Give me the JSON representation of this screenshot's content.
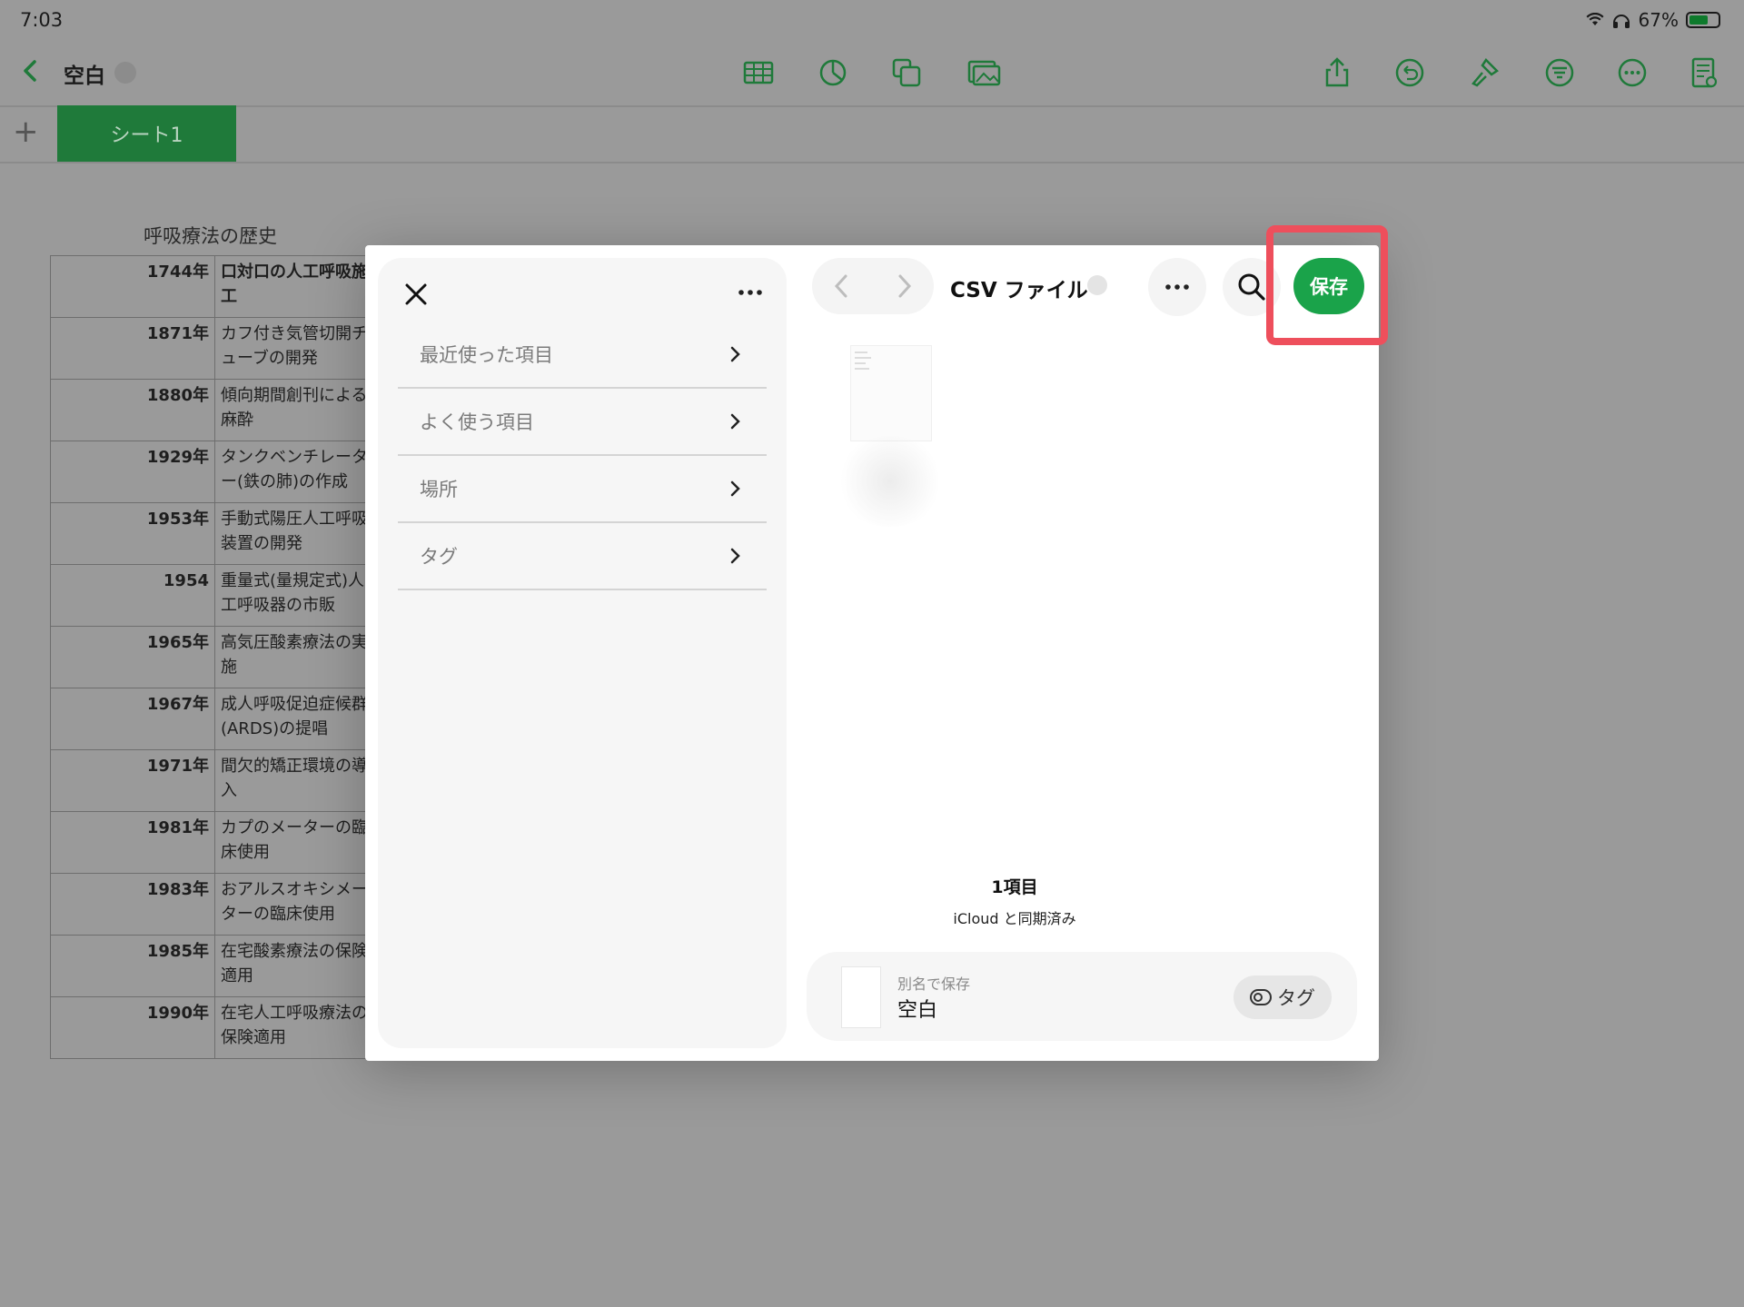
{
  "status": {
    "time": "7:03",
    "battery": "67%"
  },
  "toolbar": {
    "doc_title": "空白"
  },
  "tabs": {
    "sheet1": "シート1"
  },
  "table": {
    "title": "呼吸療法の歴史",
    "rows": [
      {
        "year": "1744年",
        "event": "口対口の人工呼吸施工"
      },
      {
        "year": "1871年",
        "event": "カフ付き気管切開チューブの開発"
      },
      {
        "year": "1880年",
        "event": "傾向期間創刊による麻酔"
      },
      {
        "year": "1929年",
        "event": "タンクベンチレーター(鉄の肺)の作成"
      },
      {
        "year": "1953年",
        "event": "手動式陽圧人工呼吸装置の開発"
      },
      {
        "year": "1954",
        "event": "重量式(量規定式)人工呼吸器の市販"
      },
      {
        "year": "1965年",
        "event": "高気圧酸素療法の実施"
      },
      {
        "year": "1967年",
        "event": "成人呼吸促迫症候群(ARDS)の提唱"
      },
      {
        "year": "1971年",
        "event": "間欠的矯正環境の導入"
      },
      {
        "year": "1981年",
        "event": "カプのメーターの臨床使用"
      },
      {
        "year": "1983年",
        "event": "おアルスオキシメーターの臨床使用"
      },
      {
        "year": "1985年",
        "event": "在宅酸素療法の保険適用"
      },
      {
        "year": "1990年",
        "event": "在宅人工呼吸療法の保険適用"
      }
    ]
  },
  "dialog": {
    "sidebar_items": [
      "最近使った項目",
      "よく使う項目",
      "場所",
      "タグ"
    ],
    "folder_title": "CSV ファイル",
    "save_button": "保存",
    "item_count": "1項目",
    "sync_status": "iCloud と同期済み",
    "save_as_label": "別名で保存",
    "save_as_name": "空白",
    "tag_button": "タグ"
  },
  "colors": {
    "accent_green": "#1aa34a",
    "highlight_red": "#ee4f5c",
    "sheet_tab": "#1f7a3a"
  }
}
